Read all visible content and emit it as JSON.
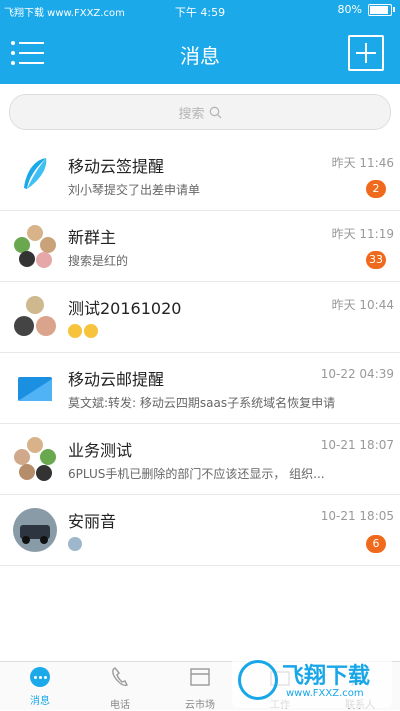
{
  "status_bar": {
    "watermark": "飞翔下载 www.FXXZ.com",
    "time": "下午 4:59",
    "battery": "80%"
  },
  "header": {
    "title": "消息"
  },
  "search": {
    "placeholder": "搜索"
  },
  "conversations": [
    {
      "name": "移动云签提醒",
      "preview": "刘小琴提交了出差申请单",
      "time": "昨天 11:46",
      "badge": "2"
    },
    {
      "name": "新群主",
      "preview": "搜索是红的",
      "time": "昨天 11:19",
      "badge": "33"
    },
    {
      "name": "测试20161020",
      "preview": "",
      "time": "昨天 10:44",
      "badge": ""
    },
    {
      "name": "移动云邮提醒",
      "preview": "莫文斌:转发: 移动云四期saas子系统域名恢复申请",
      "time": "10-22 04:39",
      "badge": ""
    },
    {
      "name": "业务测试",
      "preview": "6PLUS手机已删除的部门不应该还显示， 组织...",
      "time": "10-21 18:07",
      "badge": ""
    },
    {
      "name": "安丽音",
      "preview": "",
      "time": "10-21 18:05",
      "badge": "6"
    }
  ],
  "tabbar": {
    "tabs": [
      {
        "label": "消息",
        "icon": "chat-bubble-icon",
        "active": true
      },
      {
        "label": "电话",
        "icon": "phone-icon",
        "active": false
      },
      {
        "label": "云市场",
        "icon": "store-icon",
        "active": false
      },
      {
        "label": "工作",
        "icon": "work-icon",
        "active": false
      },
      {
        "label": "联系人",
        "icon": "contacts-icon",
        "active": false
      }
    ]
  },
  "overlay_watermark": {
    "title": "飞翔下载",
    "url": "www.FXXZ.com"
  },
  "colors": {
    "accent": "#1ba9ea",
    "badge": "#ef6a1c"
  }
}
